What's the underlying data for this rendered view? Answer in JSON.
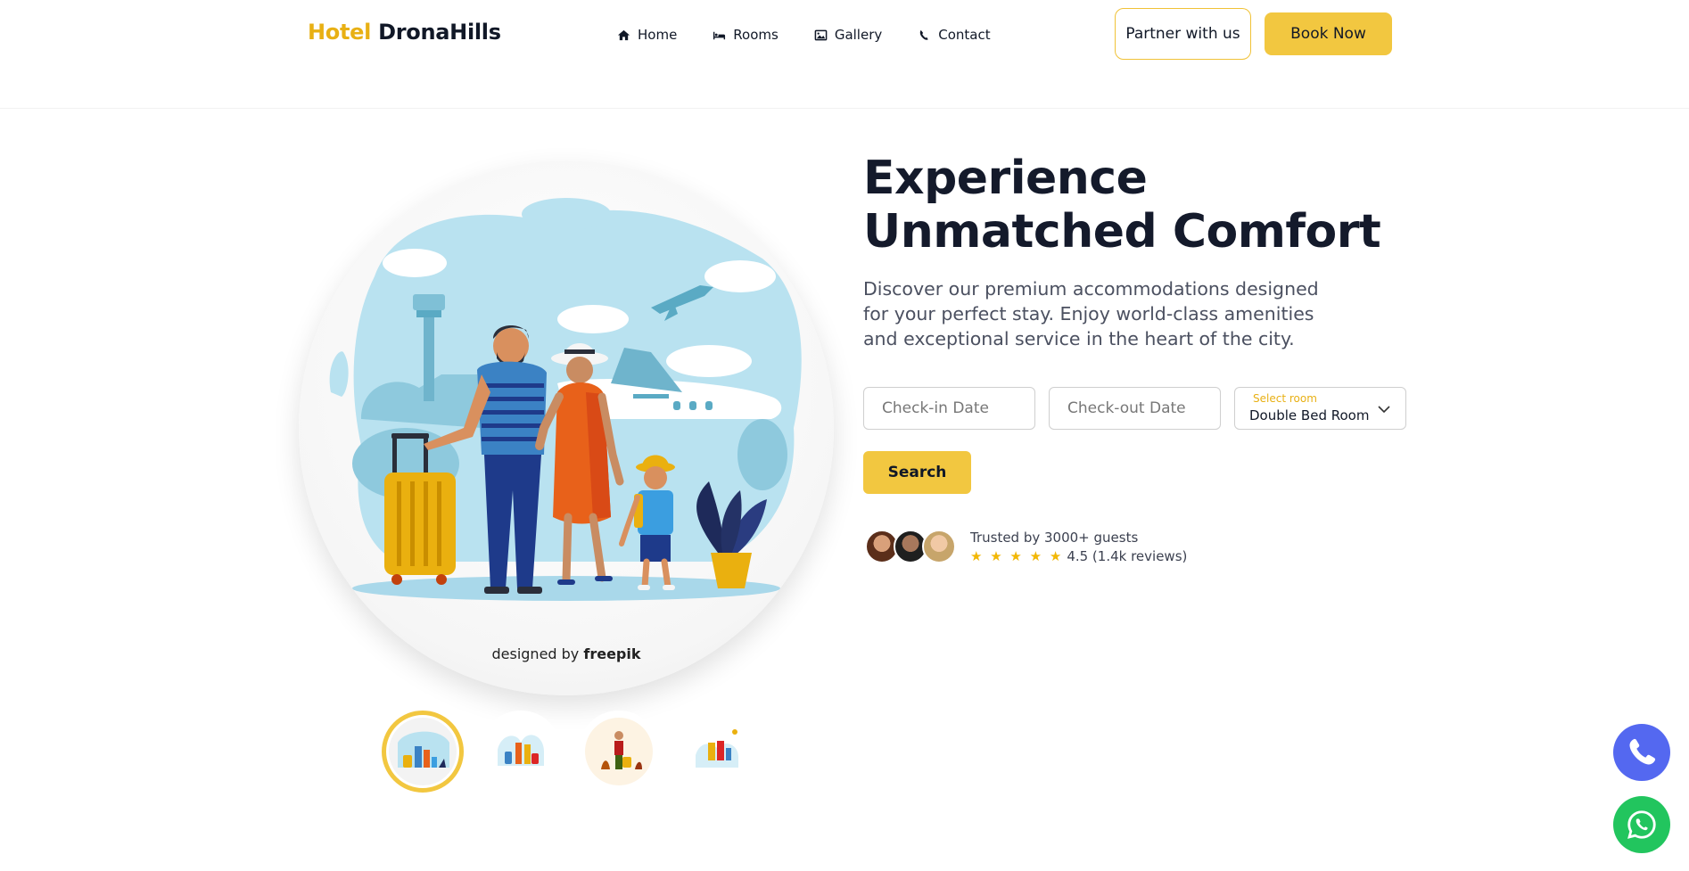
{
  "brand": {
    "prefix": "Hotel",
    "name": "DronaHills",
    "accent_color": "#e8b014"
  },
  "nav": [
    {
      "label": "Home",
      "icon": "home-icon"
    },
    {
      "label": "Rooms",
      "icon": "bed-icon"
    },
    {
      "label": "Gallery",
      "icon": "image-icon"
    },
    {
      "label": "Contact",
      "icon": "phone-handset-icon"
    }
  ],
  "header_actions": {
    "partner_label": "Partner with us",
    "book_label": "Book Now"
  },
  "hero": {
    "title": "Experience Unmatched Comfort",
    "subtitle": "Discover our premium accommodations designed for your perfect stay. Enjoy world-class amenities and exceptional service in the heart of the city.",
    "image_credit_prefix": "designed by",
    "image_credit_brand": "freepik",
    "thumbnails_count": 4,
    "active_thumbnail": 1
  },
  "booking": {
    "checkin_placeholder": "Check-in Date",
    "checkout_placeholder": "Check-out Date",
    "room_label": "Select room",
    "room_value": "Double Bed Room",
    "search_label": "Search"
  },
  "trust": {
    "text": "Trusted by 3000+ guests",
    "stars": "★ ★ ★ ★ ★",
    "rating": "4.5 (1.4k reviews)"
  },
  "colors": {
    "primary_yellow": "#f2c740",
    "phone_fab": "#5468f0",
    "whatsapp_fab": "#22c55e"
  }
}
